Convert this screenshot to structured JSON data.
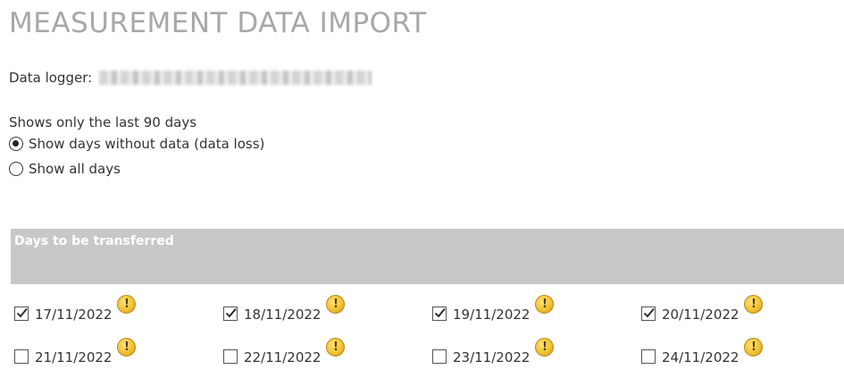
{
  "page": {
    "title": "MEASUREMENT DATA IMPORT"
  },
  "logger": {
    "label": "Data logger:"
  },
  "filter": {
    "note": "Shows only the last 90 days",
    "options": [
      {
        "label": "Show days without data (data loss)",
        "selected": true
      },
      {
        "label": "Show all days",
        "selected": false
      }
    ]
  },
  "transfer": {
    "header": "Days to be transferred",
    "warning_glyph": "!",
    "days": [
      {
        "date": "17/11/2022",
        "checked": true,
        "icon": "warning-icon"
      },
      {
        "date": "18/11/2022",
        "checked": true,
        "icon": "warning-icon"
      },
      {
        "date": "19/11/2022",
        "checked": true,
        "icon": "warning-icon"
      },
      {
        "date": "20/11/2022",
        "checked": true,
        "icon": "warning-icon"
      },
      {
        "date": "21/11/2022",
        "checked": false,
        "icon": "warning-icon"
      },
      {
        "date": "22/11/2022",
        "checked": false,
        "icon": "warning-icon"
      },
      {
        "date": "23/11/2022",
        "checked": false,
        "icon": "warning-icon"
      },
      {
        "date": "24/11/2022",
        "checked": false,
        "icon": "warning-icon"
      }
    ]
  },
  "colors": {
    "title": "#a8a8a8",
    "header_bg": "#c8c8c8",
    "header_text": "#ffffff",
    "warning": "#f1c232"
  }
}
